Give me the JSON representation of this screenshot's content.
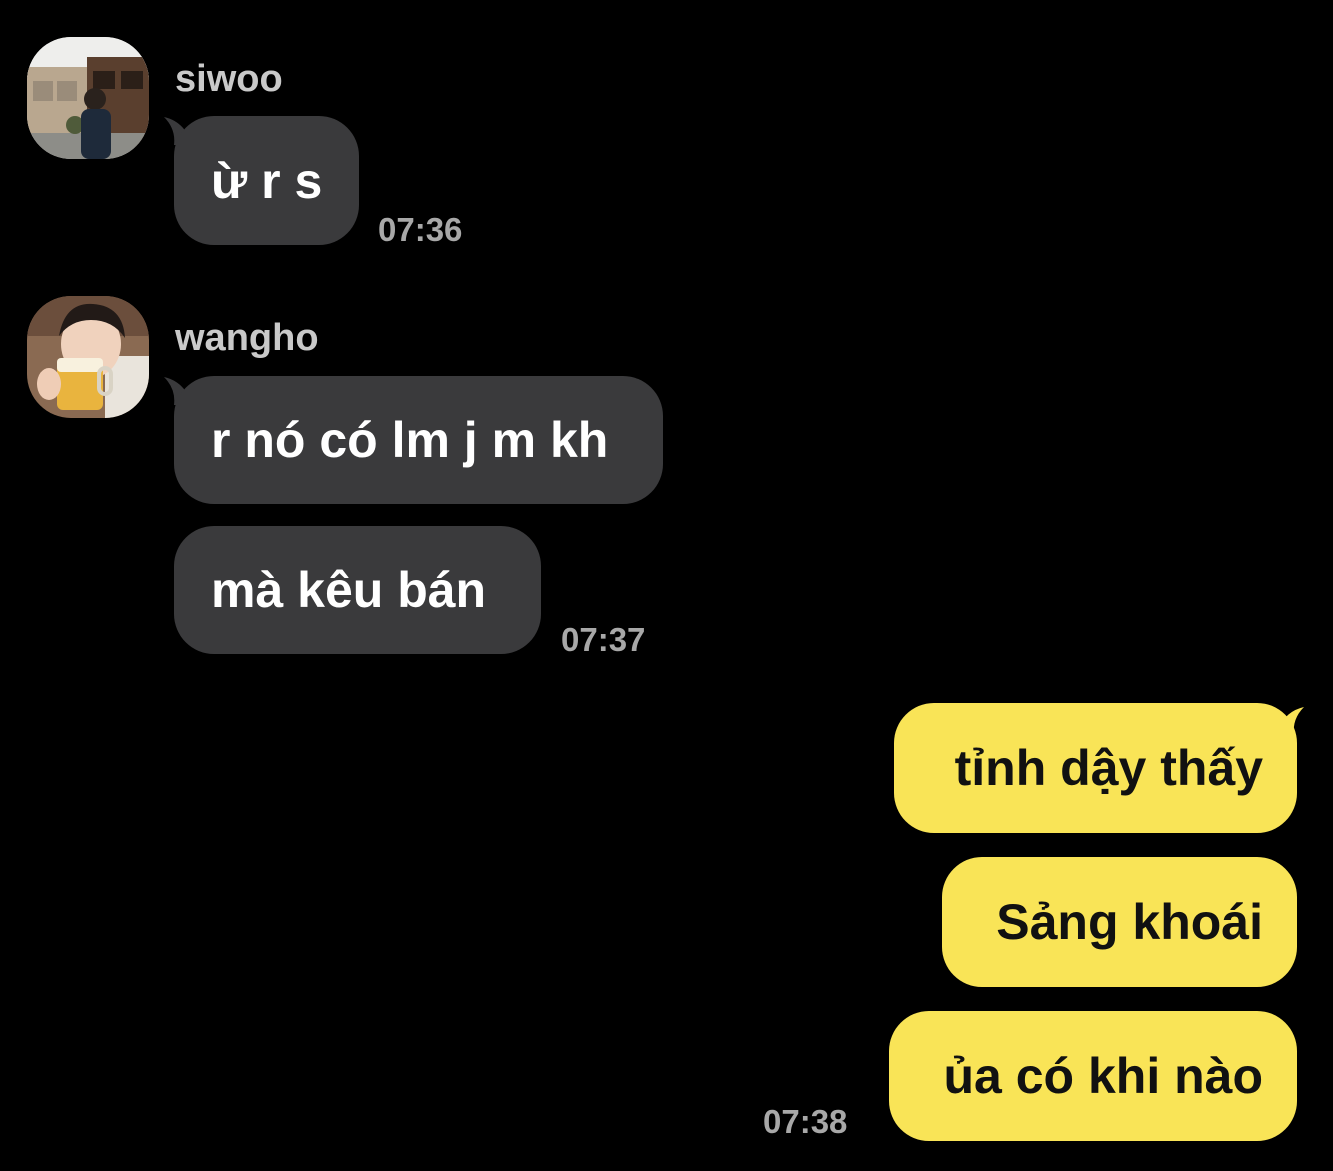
{
  "groups": [
    {
      "sender": "siwoo",
      "avatar_icon": "profile-photo-siwoo",
      "messages": [
        "ừ r s"
      ],
      "time": "07:36"
    },
    {
      "sender": "wangho",
      "avatar_icon": "profile-photo-wangho",
      "messages": [
        "r nó có lm j m kh",
        "mà kêu bán"
      ],
      "time": "07:37"
    },
    {
      "sender": "",
      "outgoing": true,
      "messages": [
        "tỉnh dậy thấy",
        "Sảng khoái",
        "ủa có khi nào"
      ],
      "time": "07:38"
    }
  ],
  "colors": {
    "background": "#000000",
    "incoming_bubble": "#3a3a3c",
    "outgoing_bubble": "#f9e457",
    "sender_name": "#c9c9c9",
    "timestamp": "#a8a8a8"
  }
}
